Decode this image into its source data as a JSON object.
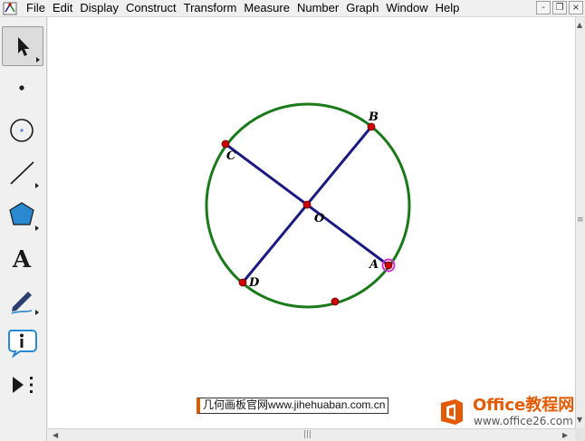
{
  "menubar": {
    "items": [
      "File",
      "Edit",
      "Display",
      "Construct",
      "Transform",
      "Measure",
      "Number",
      "Graph",
      "Window",
      "Help"
    ],
    "window_buttons": [
      "-",
      "❐",
      "×"
    ]
  },
  "toolbox": {
    "tools": [
      {
        "name": "arrow",
        "icon": "arrow-select-icon"
      },
      {
        "name": "point",
        "icon": "point-icon"
      },
      {
        "name": "compass",
        "icon": "compass-circle-icon"
      },
      {
        "name": "straightedge",
        "icon": "line-segment-icon"
      },
      {
        "name": "polygon",
        "icon": "polygon-icon"
      },
      {
        "name": "text",
        "icon": "text-a-icon",
        "label": "A"
      },
      {
        "name": "marker",
        "icon": "marker-pen-icon"
      },
      {
        "name": "information",
        "icon": "info-icon"
      },
      {
        "name": "custom",
        "icon": "custom-tool-icon"
      }
    ]
  },
  "geometry": {
    "circle_color": "#1a7a1a",
    "segment_color": "#1a1a80",
    "point_color": "#cc0000",
    "selected_ring_color": "#cc33cc",
    "points": {
      "A": "A",
      "B": "B",
      "C": "C",
      "D": "D",
      "O": "O"
    }
  },
  "watermarks": {
    "left_text": "几何画板官网www.jihehuaban.com.cn",
    "logo_title": "Office教程网",
    "logo_url": "www.office26.com",
    "logo_color": "#e35a00"
  }
}
